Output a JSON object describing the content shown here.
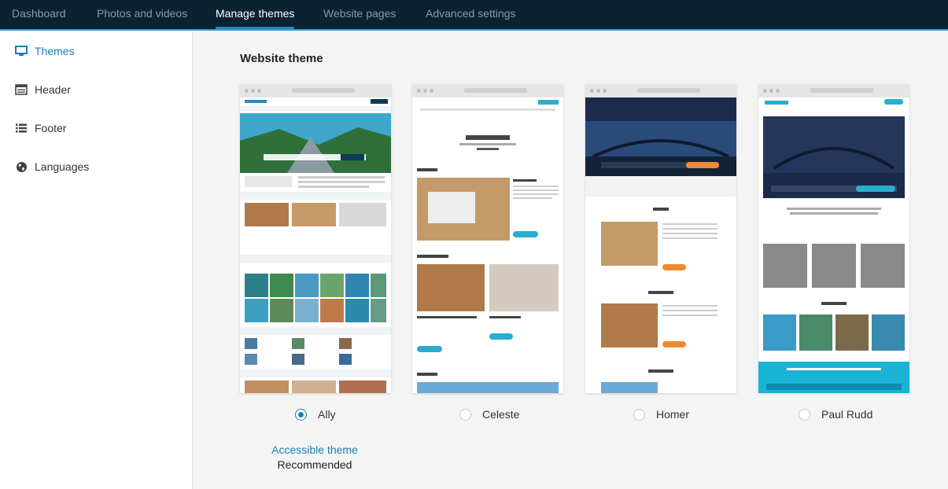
{
  "nav": {
    "tabs": [
      {
        "label": "Dashboard"
      },
      {
        "label": "Photos and videos"
      },
      {
        "label": "Manage themes"
      },
      {
        "label": "Website pages"
      },
      {
        "label": "Advanced settings"
      }
    ],
    "active_tab": "Manage themes"
  },
  "sidebar": {
    "items": [
      {
        "label": "Themes",
        "icon": "monitor-icon"
      },
      {
        "label": "Header",
        "icon": "header-icon"
      },
      {
        "label": "Footer",
        "icon": "list-icon"
      },
      {
        "label": "Languages",
        "icon": "globe-icon"
      }
    ],
    "active_item": "Themes"
  },
  "main": {
    "title": "Website theme",
    "themes": [
      {
        "name": "Ally",
        "selected": true
      },
      {
        "name": "Celeste",
        "selected": false
      },
      {
        "name": "Homer",
        "selected": false
      },
      {
        "name": "Paul Rudd",
        "selected": false
      }
    ],
    "accessible_link": "Accessible theme",
    "recommended_label": "Recommended"
  },
  "colors": {
    "nav_bg": "#0b2233",
    "accent": "#1a7fb3",
    "nav_underline": "#1f8ac0"
  }
}
